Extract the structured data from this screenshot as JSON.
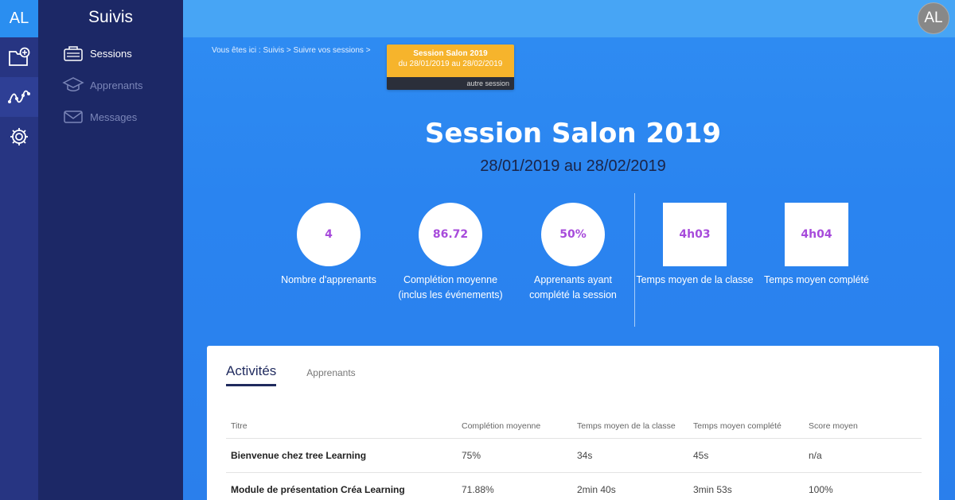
{
  "rail": {
    "logo": "AL",
    "icons": [
      "folder-add-icon",
      "activity-icon",
      "gear-icon"
    ]
  },
  "sidebar": {
    "title": "Suivis",
    "items": [
      {
        "label": "Sessions",
        "icon": "sessions-icon",
        "active": true
      },
      {
        "label": "Apprenants",
        "icon": "graduation-cap-icon",
        "active": false
      },
      {
        "label": "Messages",
        "icon": "envelope-icon",
        "active": false
      }
    ]
  },
  "header": {
    "avatar": "AL",
    "breadcrumb": "Vous êtes ici : Suivis > Suivre vos sessions >"
  },
  "session_card": {
    "name": "Session Salon 2019",
    "dates": "du 28/01/2019 au 28/02/2019",
    "other": "autre session"
  },
  "hero": {
    "title": "Session Salon 2019",
    "dates": "28/01/2019 au 28/02/2019"
  },
  "stats": [
    {
      "value": "4",
      "label": "Nombre d'apprenants"
    },
    {
      "value": "86.72",
      "label": "Complétion moyenne (inclus les événements)"
    },
    {
      "value": "50%",
      "label": "Apprenants ayant complété la session"
    },
    {
      "value": "4h03",
      "label": "Temps moyen de la classe"
    },
    {
      "value": "4h04",
      "label": "Temps moyen complété"
    }
  ],
  "tabs": {
    "active": "Activités",
    "other": "Apprenants"
  },
  "table": {
    "headers": [
      "Titre",
      "Complétion moyenne",
      "Temps moyen de la classe",
      "Temps moyen complété",
      "Score moyen"
    ],
    "rows": [
      [
        "Bienvenue chez tree Learning",
        "75%",
        "34s",
        "45s",
        "n/a"
      ],
      [
        "Module de présentation Créa Learning",
        "71.88%",
        "2min 40s",
        "3min 53s",
        "100%"
      ]
    ]
  },
  "colors": {
    "accent": "#2a8ef0",
    "stat_value": "#a74bdb",
    "card": "#f6b42c"
  }
}
